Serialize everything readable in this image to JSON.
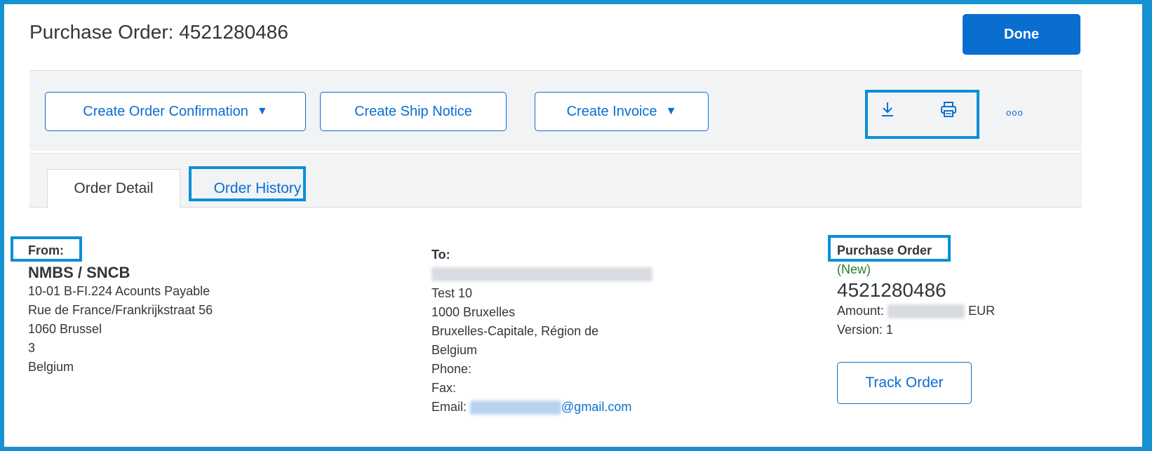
{
  "header": {
    "title": "Purchase Order: 4521280486",
    "done_label": "Done"
  },
  "toolbar": {
    "create_order_confirmation": "Create Order Confirmation",
    "create_ship_notice": "Create Ship Notice",
    "create_invoice": "Create Invoice",
    "dropdown_glyph": "▼",
    "more_glyph": "ooo"
  },
  "tabs": [
    {
      "label": "Order Detail"
    },
    {
      "label": "Order History"
    }
  ],
  "from": {
    "label": "From:",
    "name": "NMBS / SNCB",
    "lines": [
      "10-01 B-FI.224 Acounts Payable",
      "Rue de France/Frankrijkstraat 56",
      "1060 Brussel",
      "3",
      "Belgium"
    ]
  },
  "to": {
    "label": "To:",
    "lines": [
      "Test 10",
      "1000 Bruxelles",
      "Bruxelles-Capitale, Région de",
      "Belgium"
    ],
    "phone_label": "Phone:",
    "fax_label": "Fax:",
    "email_label": "Email:",
    "email_domain": "@gmail.com"
  },
  "po": {
    "label": "Purchase Order",
    "status": "(New)",
    "number": "4521280486",
    "amount_label": "Amount:",
    "amount_currency": "EUR",
    "version": "Version: 1",
    "track_label": "Track Order"
  },
  "colors": {
    "accent": "#0a6ed1",
    "highlight": "#0b8fd6",
    "status_new": "#2b7d2b"
  },
  "icons": {
    "download": "download-icon",
    "print": "print-icon",
    "more": "more-icon"
  }
}
